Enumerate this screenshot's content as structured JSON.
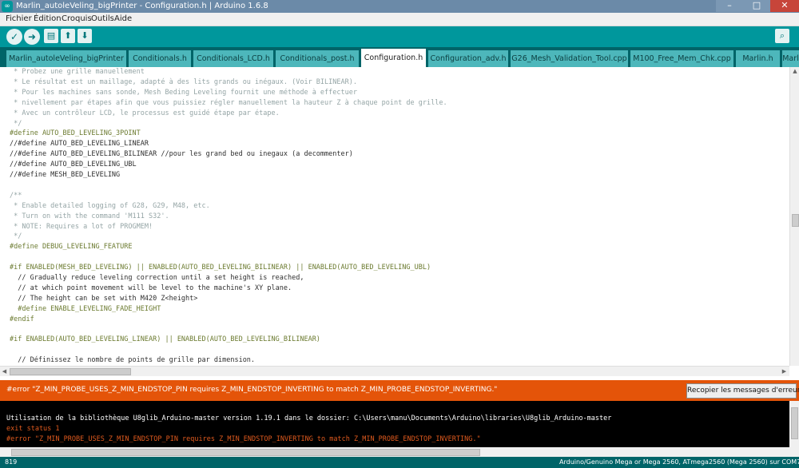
{
  "window": {
    "title": "Marlin_autoleVeling_bigPrinter - Configuration.h | Arduino 1.6.8",
    "minimize": "–",
    "maximize": "□",
    "close": "✕"
  },
  "menu": [
    "Fichier",
    "Édition",
    "Croquis",
    "Outils",
    "Aide"
  ],
  "toolbar": {
    "verify_icon": "✓",
    "upload_icon": "➜",
    "new_icon": "▤",
    "open_icon": "⬆",
    "save_icon": "⬇",
    "serial_icon": "⌕"
  },
  "tabs": [
    {
      "label": "Marlin_autoleVeling_bigPrinter",
      "active": false
    },
    {
      "label": "Conditionals.h",
      "active": false
    },
    {
      "label": "Conditionals_LCD.h",
      "active": false
    },
    {
      "label": "Conditionals_post.h",
      "active": false
    },
    {
      "label": "Configuration.h",
      "active": true
    },
    {
      "label": "Configuration_adv.h",
      "active": false
    },
    {
      "label": "G26_Mesh_Validation_Tool.cpp",
      "active": false
    },
    {
      "label": "M100_Free_Mem_Chk.cpp",
      "active": false
    },
    {
      "label": "Marlin.h",
      "active": false
    },
    {
      "label": "Marl",
      "active": false
    }
  ],
  "code": [
    {
      "text": " * Probez une grille manuellement",
      "kind": "comment"
    },
    {
      "text": " * Le résultat est un maillage, adapté à des lits grands ou inégaux. (Voir BILINEAR).",
      "kind": "comment"
    },
    {
      "text": " * Pour les machines sans sonde, Mesh Beding Leveling fournit une méthode à effectuer",
      "kind": "comment"
    },
    {
      "text": " * nivellement par étapes afin que vous puissiez régler manuellement la hauteur Z à chaque point de grille.",
      "kind": "comment"
    },
    {
      "text": " * Avec un contrôleur LCD, le processus est guidé étape par étape.",
      "kind": "comment"
    },
    {
      "text": " */",
      "kind": "comment"
    },
    {
      "text": "#define AUTO_BED_LEVELING_3POINT",
      "kind": "pp"
    },
    {
      "text": "//#define AUTO_BED_LEVELING_LINEAR",
      "kind": "plain"
    },
    {
      "text": "//#define AUTO_BED_LEVELING_BILINEAR //pour les grand bed ou inegaux (a decommenter)",
      "kind": "plain"
    },
    {
      "text": "//#define AUTO_BED_LEVELING_UBL",
      "kind": "plain"
    },
    {
      "text": "//#define MESH_BED_LEVELING",
      "kind": "plain"
    },
    {
      "text": "",
      "kind": "plain"
    },
    {
      "text": "/**",
      "kind": "comment"
    },
    {
      "text": " * Enable detailed logging of G28, G29, M48, etc.",
      "kind": "comment"
    },
    {
      "text": " * Turn on with the command 'M111 S32'.",
      "kind": "comment"
    },
    {
      "text": " * NOTE: Requires a lot of PROGMEM!",
      "kind": "comment"
    },
    {
      "text": " */",
      "kind": "comment"
    },
    {
      "text": "#define DEBUG_LEVELING_FEATURE",
      "kind": "pp"
    },
    {
      "text": "",
      "kind": "plain"
    },
    {
      "text": "#if ENABLED(MESH_BED_LEVELING) || ENABLED(AUTO_BED_LEVELING_BILINEAR) || ENABLED(AUTO_BED_LEVELING_UBL)",
      "kind": "pp"
    },
    {
      "text": "  // Gradually reduce leveling correction until a set height is reached,",
      "kind": "plain"
    },
    {
      "text": "  // at which point movement will be level to the machine's XY plane.",
      "kind": "plain"
    },
    {
      "text": "  // The height can be set with M420 Z<height>",
      "kind": "plain"
    },
    {
      "text": "  #define ENABLE_LEVELING_FADE_HEIGHT",
      "kind": "pp"
    },
    {
      "text": "#endif",
      "kind": "pp"
    },
    {
      "text": "",
      "kind": "plain"
    },
    {
      "text": "#if ENABLED(AUTO_BED_LEVELING_LINEAR) || ENABLED(AUTO_BED_LEVELING_BILINEAR)",
      "kind": "pp"
    },
    {
      "text": "",
      "kind": "plain"
    },
    {
      "text": "  // Définissez le nombre de points de grille par dimension.",
      "kind": "plain"
    }
  ],
  "error_bar": {
    "message": "#error \"Z_MIN_PROBE_USES_Z_MIN_ENDSTOP_PIN requires Z_MIN_ENDSTOP_INVERTING to match Z_MIN_PROBE_ENDSTOP_INVERTING.\"",
    "copy_button": "Recopier les messages d'erreur"
  },
  "console": [
    {
      "text": "Utilisation de la bibliothèque U8glib_Arduino-master version 1.19.1 dans le dossier: C:\\Users\\manu\\Documents\\Arduino\\libraries\\U8glib_Arduino-master",
      "kind": "info"
    },
    {
      "text": "exit status 1",
      "kind": "error"
    },
    {
      "text": "#error \"Z_MIN_PROBE_USES_Z_MIN_ENDSTOP_PIN requires Z_MIN_ENDSTOP_INVERTING to match Z_MIN_PROBE_ENDSTOP_INVERTING.\"",
      "kind": "error"
    }
  ],
  "status": {
    "line": "819",
    "board": "Arduino/Genuino Mega or Mega 2560, ATmega2560 (Mega 2560) sur COM7"
  },
  "colors": {
    "teal_toolbar": "#00979c",
    "teal_dark": "#006468",
    "error_orange": "#e45409",
    "console_error": "#e05a1e",
    "console_text": "#ffffff"
  }
}
